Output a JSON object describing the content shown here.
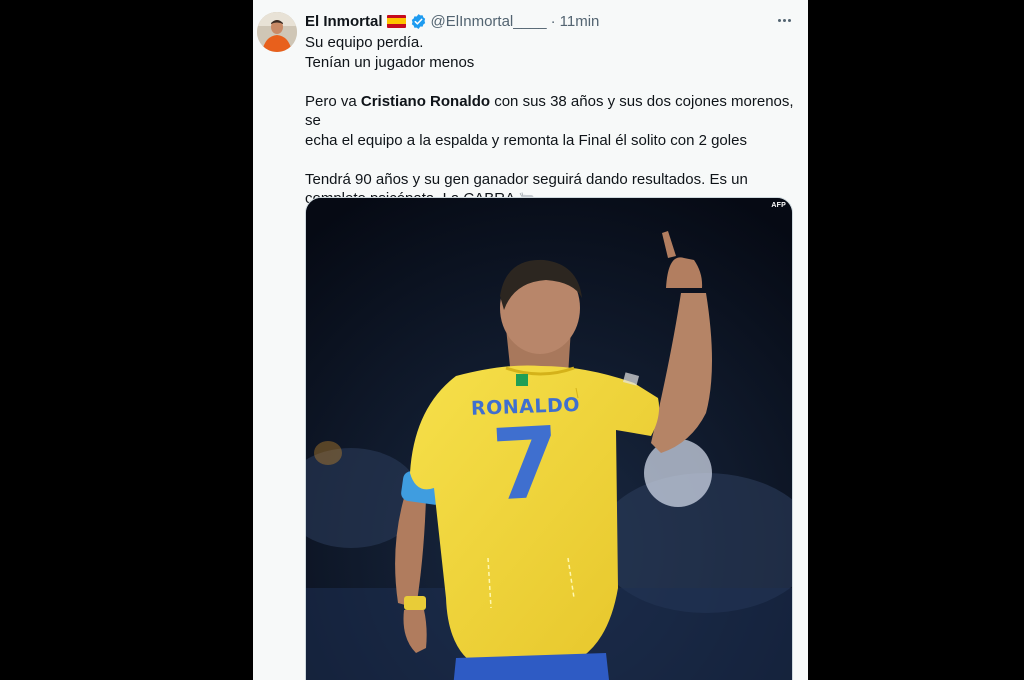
{
  "tweet": {
    "author": {
      "display_name": "El Inmortal",
      "flag": "spain-flag-icon",
      "verified": true,
      "handle": "@ElInmortal____",
      "time": "11min"
    },
    "text": {
      "line1": "Su equipo perdía.",
      "line2": "Tenían un jugador menos",
      "p2_before": "Pero va ",
      "p2_bold": "Cristiano Ronaldo",
      "p2_after_l1": " con sus 38 años y sus dos cojones morenos, se",
      "p2_l2": "echa el equipo a la espalda y remonta la Final él solito con 2 goles",
      "p3_l1": "Tendrá 90 años y su gen ganador seguirá dando resultados. Es un",
      "p3_l2": "completo psicópata. La CABRA",
      "emoji": "goat-icon"
    },
    "media": {
      "watermark": "AFP",
      "jersey_name": "RONALDO",
      "jersey_number": "7"
    }
  },
  "colors": {
    "card_bg": "#f7f9f9",
    "text": "#0f1419",
    "muted": "#536471",
    "verified": "#1d9bf0",
    "jersey_yellow": "#f4d83a",
    "jersey_blue": "#3f6fcf"
  }
}
